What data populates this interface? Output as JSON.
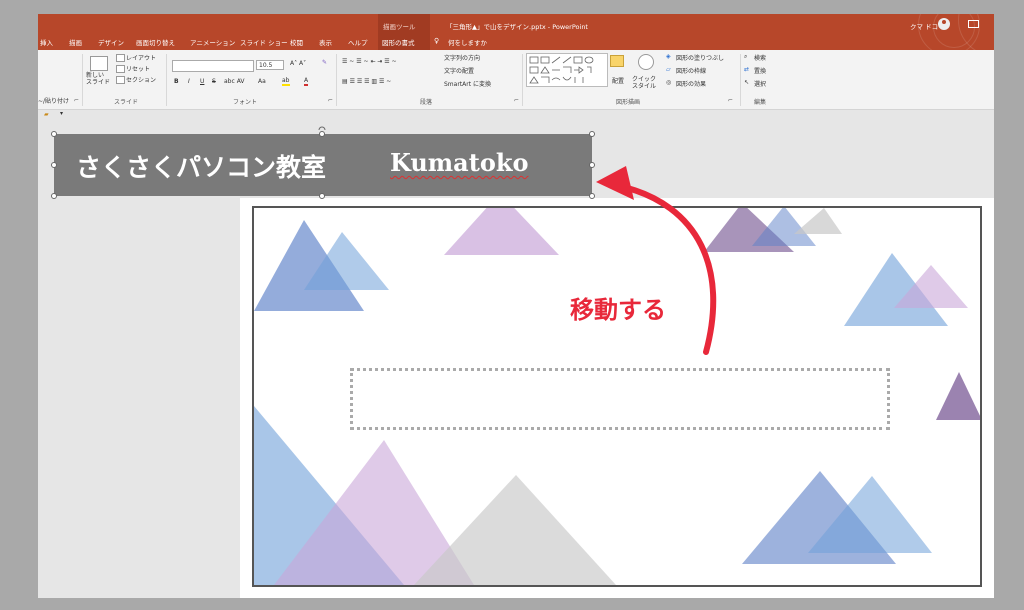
{
  "titlebar": {
    "context_tool": "描画ツール",
    "doc_title": "「三角形▲」で山をデザイン.pptx - PowerPoint",
    "user": "クマ ドコ"
  },
  "tabs": [
    {
      "label": "挿入"
    },
    {
      "label": "描画"
    },
    {
      "label": "デザイン"
    },
    {
      "label": "画面切り替え"
    },
    {
      "label": "アニメーション"
    },
    {
      "label": "スライド ショー"
    },
    {
      "label": "校閲"
    },
    {
      "label": "表示"
    },
    {
      "label": "ヘルプ"
    },
    {
      "label": "図形の書式"
    }
  ],
  "tell_me": "何をしますか",
  "ribbon": {
    "paste": "~/貼り付け",
    "new_slide": "新しい\nスライド",
    "layout": "レイアウト",
    "reset": "リセット",
    "section": "セクション",
    "group_clipboard": "",
    "group_slides": "スライド",
    "font_size": "10.5",
    "group_font": "フォント",
    "text_direction": "文字列の方向",
    "align_text": "文字の配置",
    "smartart": "SmartArt に変換",
    "group_paragraph": "段落",
    "arrange": "配置",
    "quick_styles": "クイック\nスタイル",
    "shape_fill": "図形の塗りつぶし",
    "shape_outline": "図形の枠線",
    "shape_effects": "図形の効果",
    "group_drawing": "図形描画",
    "find": "検索",
    "replace": "置換",
    "select": "選択",
    "group_editing": "編集"
  },
  "banner": {
    "school": "さくさくパソコン教室",
    "brand": "Kumatoko"
  },
  "annotation": "移動する",
  "colors": {
    "accent": "#b7472a",
    "annotation": "#e8283a",
    "banner": "#7a7a7a"
  }
}
